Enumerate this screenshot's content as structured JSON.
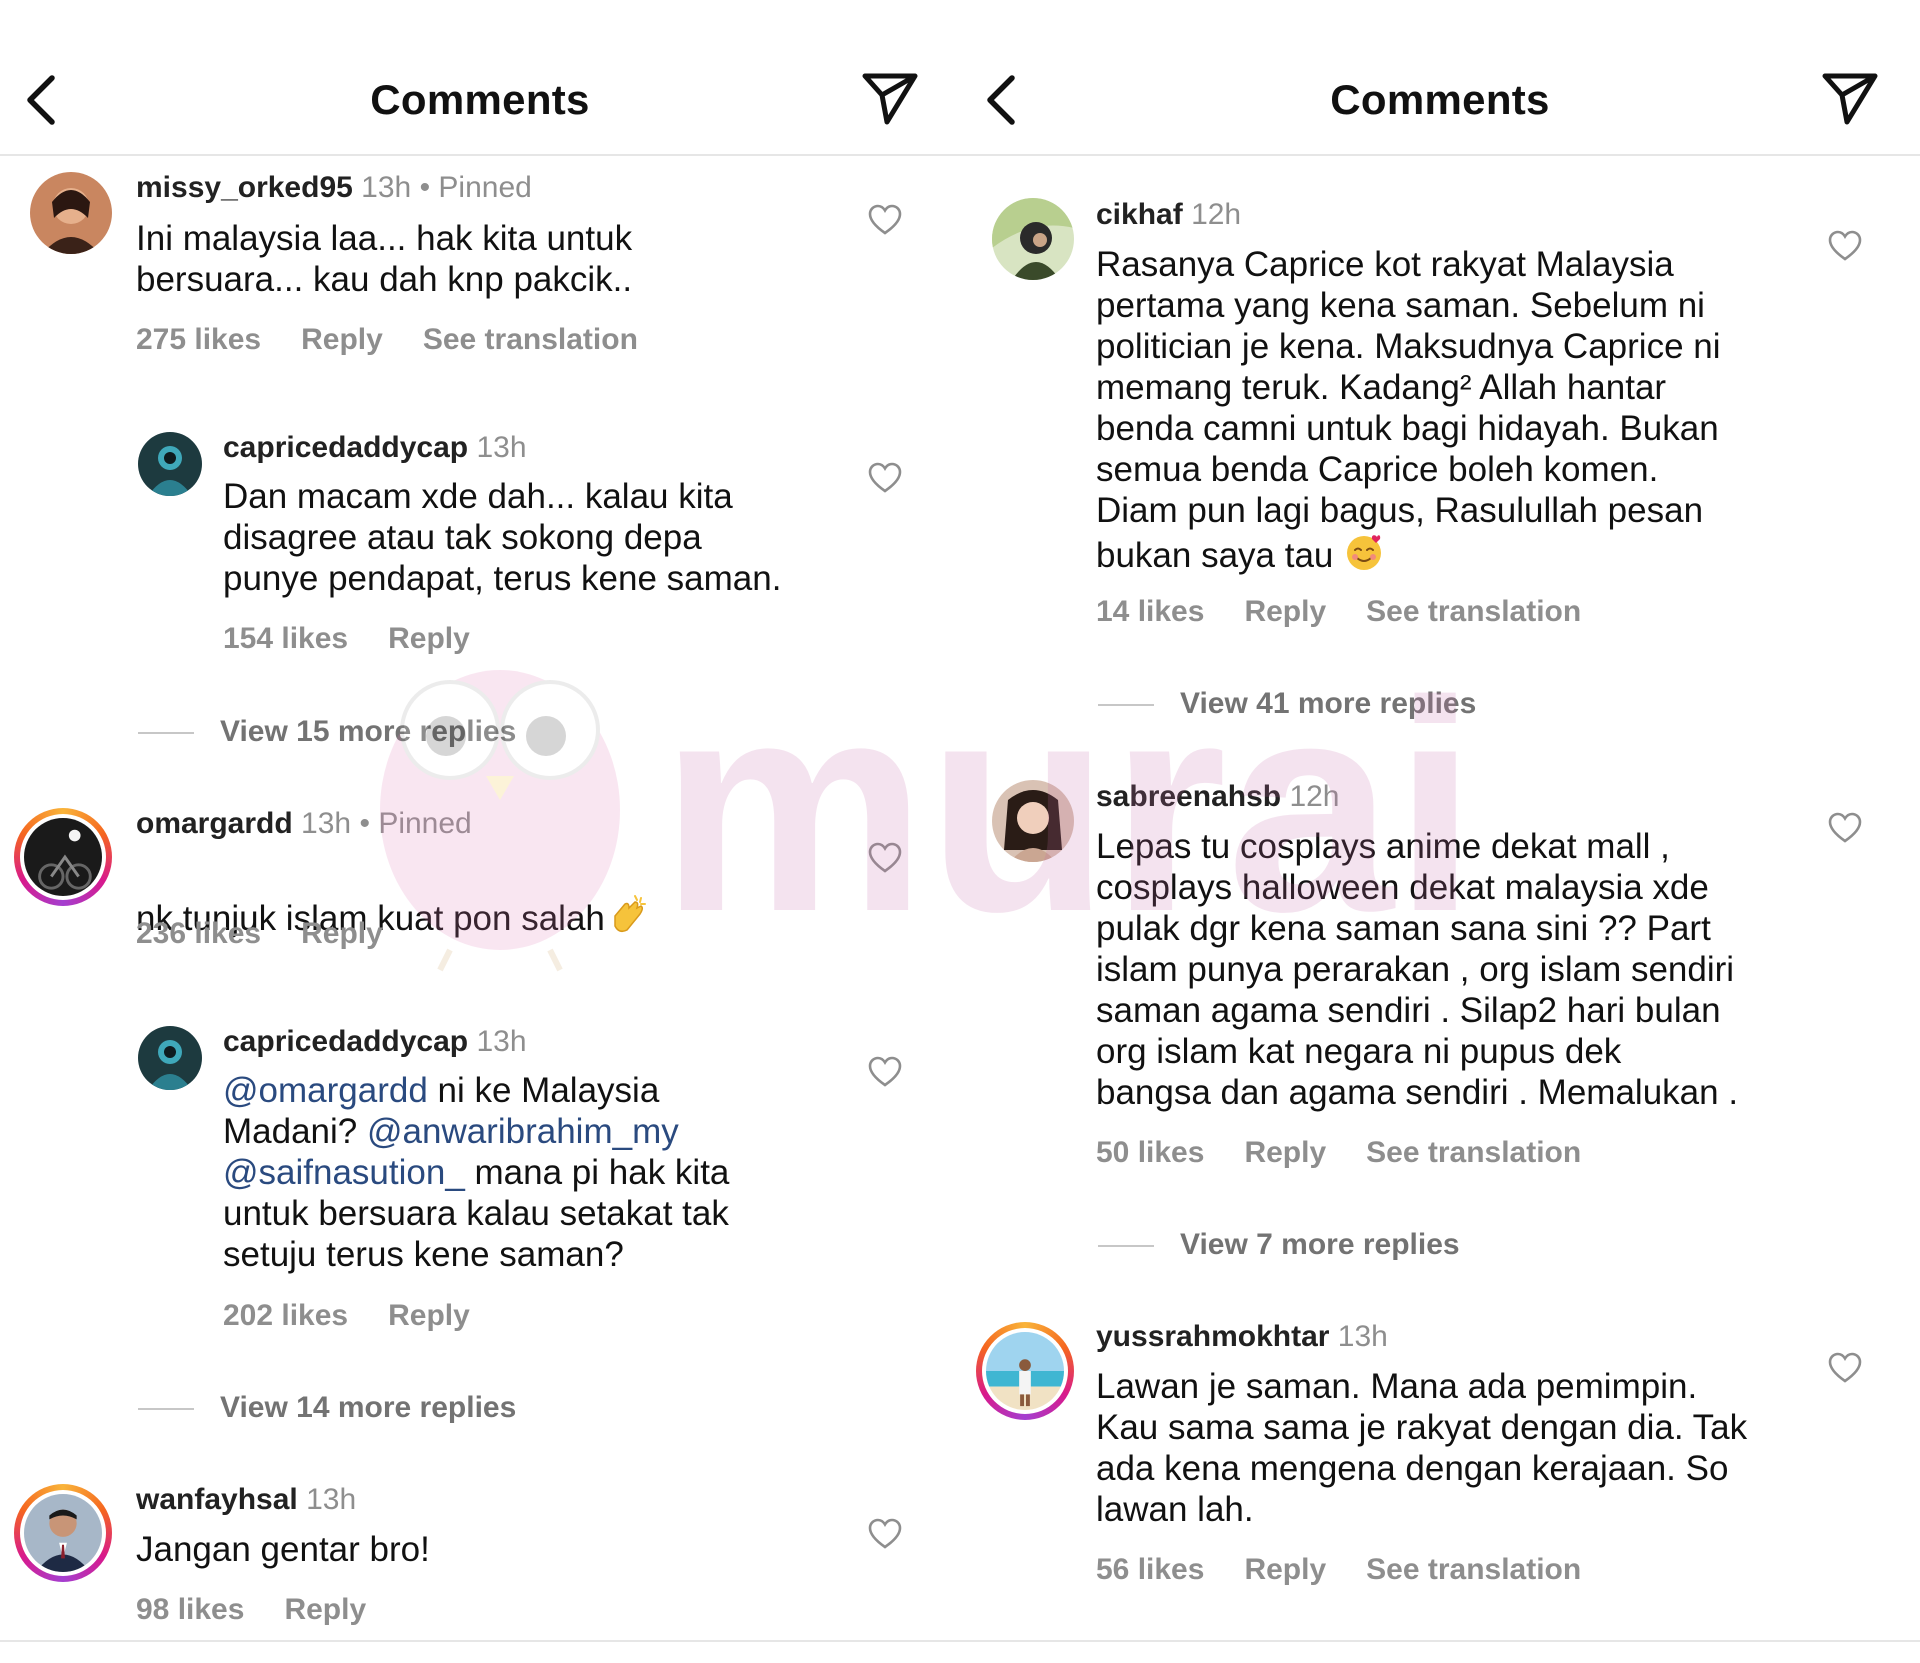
{
  "left": {
    "title": "Comments",
    "comments": [
      {
        "username": "missy_orked95",
        "time": "13h",
        "pinned": "Pinned",
        "text": "Ini malaysia laa... hak kita untuk\nbersuara... kau dah knp pakcik..",
        "likes": "275 likes",
        "reply": "Reply",
        "translate": "See translation"
      },
      {
        "username": "capricedaddycap",
        "time": "13h",
        "text": "Dan macam xde dah... kalau kita\ndisagree atau tak sokong depa\npunye pendapat, terus kene saman.",
        "likes": "154 likes",
        "reply": "Reply"
      },
      {
        "view_more": "View 15 more replies"
      },
      {
        "username": "omargardd",
        "time": "13h",
        "pinned": "Pinned",
        "text": "nk tunjuk islam kuat pon salah",
        "likes": "236 likes",
        "reply": "Reply"
      },
      {
        "username": "capricedaddycap",
        "time": "13h",
        "text_parts": [
          "@omargardd",
          " ni ke Malaysia\nMadani? ",
          "@anwaribrahim_my",
          "\n",
          "@saifnasution_",
          " mana pi hak kita\nuntuk bersuara kalau setakat tak\nsetuju terus kene saman?"
        ],
        "likes": "202 likes",
        "reply": "Reply"
      },
      {
        "view_more": "View 14 more replies"
      },
      {
        "username": "wanfayhsal",
        "time": "13h",
        "text": "Jangan gentar bro!",
        "likes": "98 likes",
        "reply": "Reply"
      }
    ]
  },
  "right": {
    "title": "Comments",
    "comments": [
      {
        "username": "cikhaf",
        "time": "12h",
        "text": "Rasanya Caprice kot rakyat Malaysia\npertama yang kena saman. Sebelum ni\npolitician je kena. Maksudnya Caprice ni\nmemang teruk. Kadang² Allah hantar\nbenda camni untuk bagi hidayah. Bukan\nsemua benda Caprice boleh komen.\nDiam pun lagi bagus, Rasulullah pesan\nbukan saya tau",
        "likes": "14 likes",
        "reply": "Reply",
        "translate": "See translation"
      },
      {
        "view_more": "View 41 more replies"
      },
      {
        "username": "sabreenahsb",
        "time": "12h",
        "text": "Lepas tu cosplays anime dekat mall ,\ncosplays halloween dekat malaysia xde\npulak dgr kena saman sana sini ?? Part\nislam punya perarakan , org islam sendiri\nsaman agama sendiri . Silap2 hari bulan\norg islam kat negara ni pupus dek\nbangsa dan agama sendiri . Memalukan .",
        "likes": "50 likes",
        "reply": "Reply",
        "translate": "See translation"
      },
      {
        "view_more": "View 7 more replies"
      },
      {
        "username": "yussrahmokhtar",
        "time": "13h",
        "text": "Lawan je saman. Mana ada pemimpin.\nKau sama sama je rakyat dengan dia. Tak\nada kena mengena dengan kerajaan. So\nlawan lah.",
        "likes": "56 likes",
        "reply": "Reply",
        "translate": "See translation"
      }
    ]
  },
  "watermark": "murai",
  "icons": {
    "back": "chevron-left-icon",
    "send": "paper-plane-icon",
    "like": "heart-outline-icon",
    "clap": "clapping-hands-emoji",
    "smile": "smiling-face-with-hearts-emoji"
  }
}
